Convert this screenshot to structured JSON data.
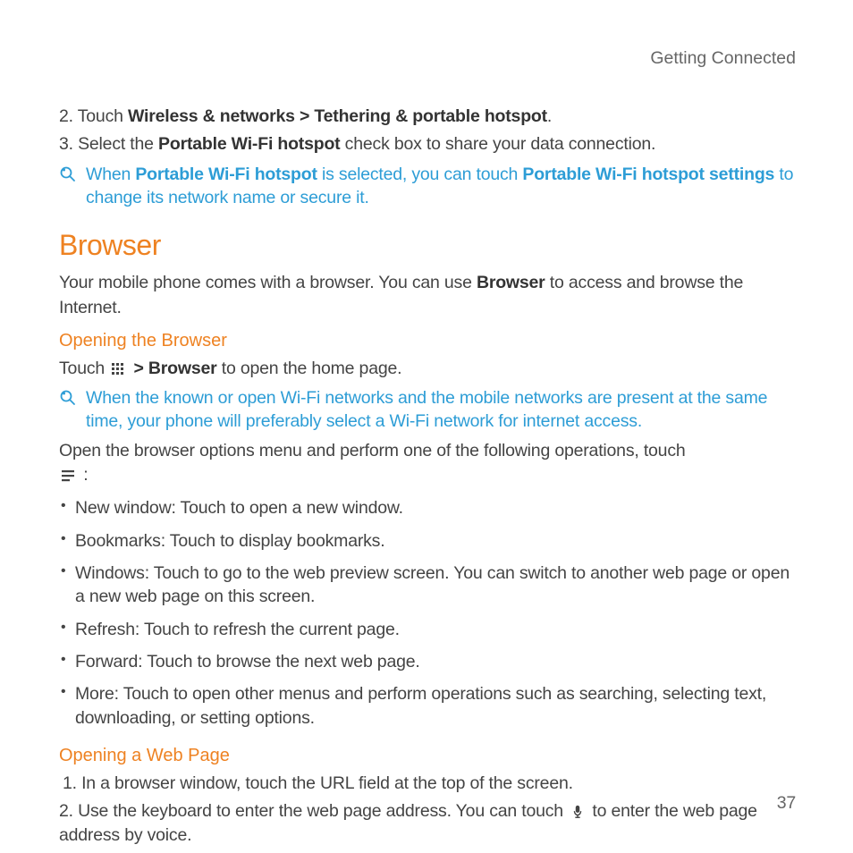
{
  "page": {
    "header": "Getting Connected",
    "number": "37"
  },
  "steps_top": {
    "s2_num": "2. ",
    "s2_pre": "Touch ",
    "s2_bold": "Wireless & networks > Tethering & portable hotspot",
    "s2_post": ".",
    "s3_num": "3. ",
    "s3_pre": "Select the ",
    "s3_bold": "Portable Wi-Fi hotspot",
    "s3_post": " check box to share your data connection."
  },
  "note1": {
    "pre": "When ",
    "b1": "Portable Wi-Fi hotspot",
    "mid": " is selected, you can touch ",
    "b2": "Portable Wi-Fi hotspot settings",
    "post": " to change its network name or secure it."
  },
  "section": {
    "title": "Browser",
    "intro_pre": "Your mobile phone comes with a browser. You can use ",
    "intro_bold": "Browser",
    "intro_post": " to access and browse the Internet."
  },
  "opening_browser": {
    "title": "Opening the Browser",
    "line_pre": "Touch ",
    "line_mid": " > ",
    "line_bold": "Browser",
    "line_post": " to open the home page."
  },
  "note2": {
    "text": "When the known or open Wi-Fi networks and the mobile networks are present at the same time, your phone will preferably select a Wi-Fi network for internet access."
  },
  "options": {
    "intro": "Open the browser options menu and perform one of the following operations, touch ",
    "intro_post": " :",
    "items": [
      "New window: Touch to open a new window.",
      "Bookmarks: Touch to display bookmarks.",
      "Windows: Touch to go to the web preview screen. You can switch to another web page or open a new web page on this screen.",
      "Refresh: Touch to refresh the current page.",
      "Forward: Touch to browse the next web page.",
      "More: Touch to open other menus and perform operations such as searching, selecting text, downloading, or setting options."
    ]
  },
  "opening_webpage": {
    "title": "Opening a Web Page",
    "s1_num": "1. ",
    "s1_text": "In a browser window, touch the URL field at the top of the screen.",
    "s2_num": "2. ",
    "s2_pre": "Use the keyboard to enter the web page address. You can touch ",
    "s2_post": " to enter the web page address by voice."
  }
}
